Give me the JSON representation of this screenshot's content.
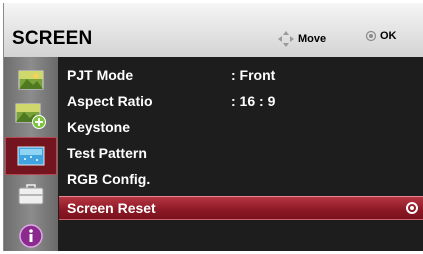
{
  "header": {
    "title": "SCREEN",
    "hint_move": "Move",
    "hint_ok": "OK"
  },
  "sidebar": {
    "icons": [
      "picture-icon",
      "picture-plus-icon",
      "screen-icon",
      "briefcase-icon",
      "info-icon"
    ],
    "active_index": 2
  },
  "menu": {
    "items": [
      {
        "label": "PJT Mode",
        "value": ": Front"
      },
      {
        "label": "Aspect Ratio",
        "value": ": 16 : 9"
      },
      {
        "label": "Keystone",
        "value": ""
      },
      {
        "label": "Test Pattern",
        "value": ""
      },
      {
        "label": "RGB Config.",
        "value": ""
      },
      {
        "label": "Screen Reset",
        "value": ""
      }
    ],
    "selected_index": 5
  },
  "colors": {
    "accent": "#8a1824",
    "panel": "#1d1d1d",
    "header": "#e4e4e4"
  }
}
